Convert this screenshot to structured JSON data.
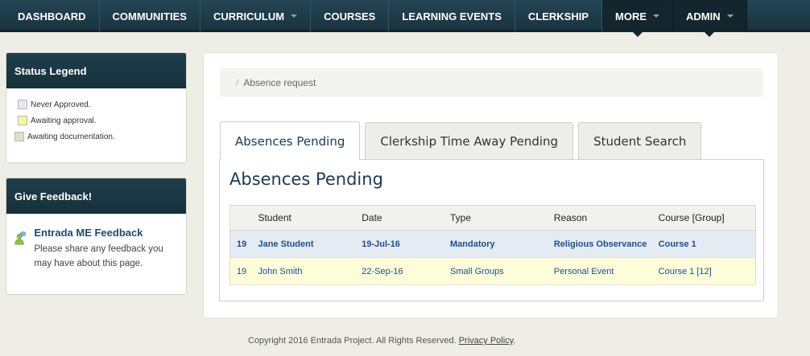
{
  "nav": {
    "items": [
      {
        "label": "DASHBOARD"
      },
      {
        "label": "COMMUNITIES"
      },
      {
        "label": "CURRICULUM"
      },
      {
        "label": "COURSES"
      },
      {
        "label": "LEARNING EVENTS"
      },
      {
        "label": "CLERKSHIP"
      },
      {
        "label": "MORE"
      },
      {
        "label": "ADMIN"
      }
    ]
  },
  "status_legend": {
    "title": "Status Legend",
    "items": [
      {
        "label": "Never Approved.",
        "color": "#e4ebf3"
      },
      {
        "label": "Awaiting approval.",
        "color": "#f5f5a8"
      },
      {
        "label": "Awaiting documentation.",
        "color": "#d7e4c8"
      }
    ]
  },
  "feedback": {
    "title": "Give Feedback!",
    "link_label": "Entrada ME Feedback",
    "text": "Please share any feedback you may have about this page."
  },
  "breadcrumb": {
    "separator": "/",
    "current": "Absence request"
  },
  "tabs": [
    {
      "label": "Absences Pending"
    },
    {
      "label": "Clerkship Time Away Pending"
    },
    {
      "label": "Student Search"
    }
  ],
  "section_title": "Absences Pending",
  "table": {
    "headers": [
      "",
      "Student",
      "Date",
      "Type",
      "Reason",
      "Course [Group]"
    ],
    "rows": [
      {
        "id": "19",
        "student": "Jane Student",
        "date": "19-Jul-16",
        "type": "Mandatory",
        "reason": "Religious Observance",
        "course": "Course 1"
      },
      {
        "id": "19",
        "student": "John Smith",
        "date": "22-Sep-16",
        "type": "Small Groups",
        "reason": "Personal Event",
        "course": "Course 1 [12]"
      }
    ]
  },
  "footer": {
    "copyright": "Copyright 2016 Entrada Project. All Rights Reserved.",
    "privacy_label": "Privacy Policy",
    "period": "."
  }
}
